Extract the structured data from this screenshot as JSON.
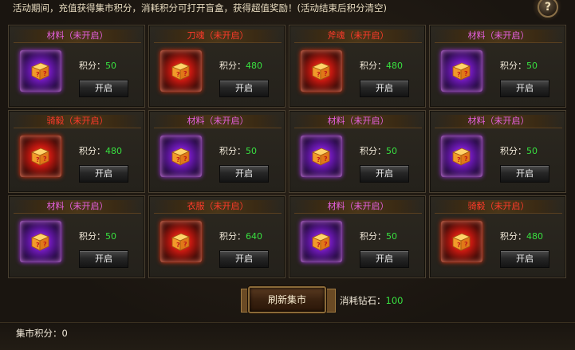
{
  "notice": "活动期间，充值获得集市积分，消耗积分可打开盲盒，获得超值奖励！(活动结束后积分清空)",
  "help_label": "?",
  "score_label": "积分：",
  "open_label": "开启",
  "cards": [
    {
      "title": "材料（未开启）",
      "title_color": "mat",
      "glow": "purple",
      "score": "50"
    },
    {
      "title": "刀魂（未开启）",
      "title_color": "red",
      "glow": "red",
      "score": "480"
    },
    {
      "title": "斧魂（未开启）",
      "title_color": "red",
      "glow": "red",
      "score": "480"
    },
    {
      "title": "材料（未开启）",
      "title_color": "mat",
      "glow": "purple",
      "score": "50"
    },
    {
      "title": "骑毅（未开启）",
      "title_color": "red",
      "glow": "red",
      "score": "480"
    },
    {
      "title": "材料（未开启）",
      "title_color": "mat",
      "glow": "purple",
      "score": "50"
    },
    {
      "title": "材料（未开启）",
      "title_color": "mat",
      "glow": "purple",
      "score": "50"
    },
    {
      "title": "材料（未开启）",
      "title_color": "mat",
      "glow": "purple",
      "score": "50"
    },
    {
      "title": "材料（未开启）",
      "title_color": "mat",
      "glow": "purple",
      "score": "50"
    },
    {
      "title": "衣服（未开启）",
      "title_color": "red",
      "glow": "red",
      "score": "640"
    },
    {
      "title": "材料（未开启）",
      "title_color": "mat",
      "glow": "purple",
      "score": "50"
    },
    {
      "title": "骑毅（未开启）",
      "title_color": "red",
      "glow": "red",
      "score": "480"
    }
  ],
  "refresh_label": "刷新集市",
  "cost_label": "消耗钻石：",
  "cost_value": "100",
  "market_score_label": "集市积分：",
  "market_score_value": "0",
  "colors": {
    "score_green": "#38e040",
    "title_purple": "#e860e0",
    "title_red": "#ff3a2a"
  }
}
